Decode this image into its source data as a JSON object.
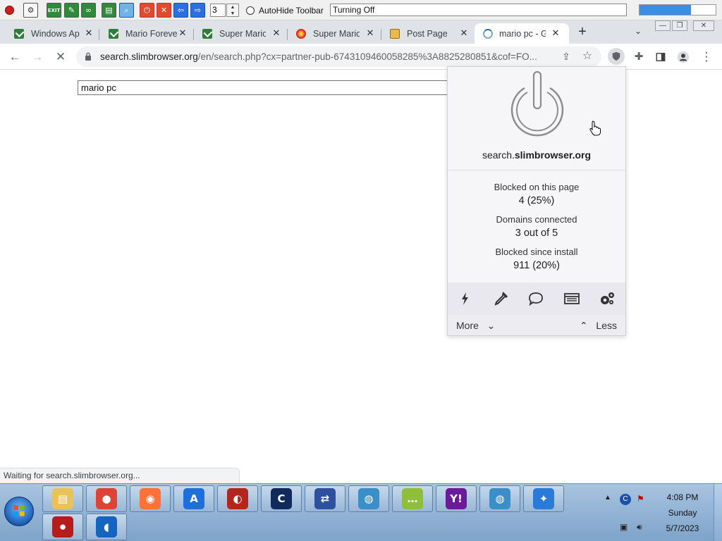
{
  "top_toolbar": {
    "spinner_value": "3",
    "autohide_label": "AutoHide Toolbar",
    "status_text": "Turning Off",
    "progress": 0.68,
    "exit_label": "EXIT"
  },
  "tabs": [
    {
      "title": "Windows Ap",
      "favicon": "green-check-icon"
    },
    {
      "title": "Mario Foreve",
      "favicon": "green-check-icon"
    },
    {
      "title": "Super Mario",
      "favicon": "green-check-icon"
    },
    {
      "title": "Super Mario",
      "favicon": "mario-sprite-icon"
    },
    {
      "title": "Post Page",
      "favicon": "post-page-icon"
    },
    {
      "title": "mario pc - G",
      "favicon": "loading-spinner-icon",
      "active": true
    }
  ],
  "address": {
    "host": "search.slimbrowser.org",
    "path": "/en/search.php?cx=partner-pub-6743109460058285%3A8825280851&cof=FO..."
  },
  "page": {
    "search_value": "mario pc"
  },
  "ublock_popup": {
    "domain_prefix": "search.",
    "domain_main": "slimbrowser.org",
    "blocked_page_label": "Blocked on this page",
    "blocked_page_value": "4 (25%)",
    "domains_label": "Domains connected",
    "domains_value": "3 out of 5",
    "blocked_install_label": "Blocked since install",
    "blocked_install_value": "911 (20%)",
    "more_label": "More",
    "less_label": "Less"
  },
  "status_bubble": "Waiting for search.slimbrowser.org...",
  "taskbar": {
    "pinned_top": [
      "file-explorer-icon",
      "chrome-icon",
      "firefox-icon",
      "app-a-icon",
      "slimjet-icon",
      "ccleaner-icon",
      "remote-app-icon",
      "slimbrowser-icon",
      "talk-icon",
      "yahoo-messenger-icon",
      "slimbrowser-alt-icon",
      "safari-icon"
    ],
    "pinned_bottom": [
      "screen-recorder-icon",
      "opera-gx-icon"
    ],
    "clock_time": "4:08 PM",
    "clock_day": "Sunday",
    "clock_date": "5/7/2023"
  },
  "colors": {
    "tab_strip": "#dfe3e7",
    "omnibox": "#f1f3f4",
    "popup_bg": "#f6f6f8",
    "progress_fill": "#3a8ee6"
  }
}
